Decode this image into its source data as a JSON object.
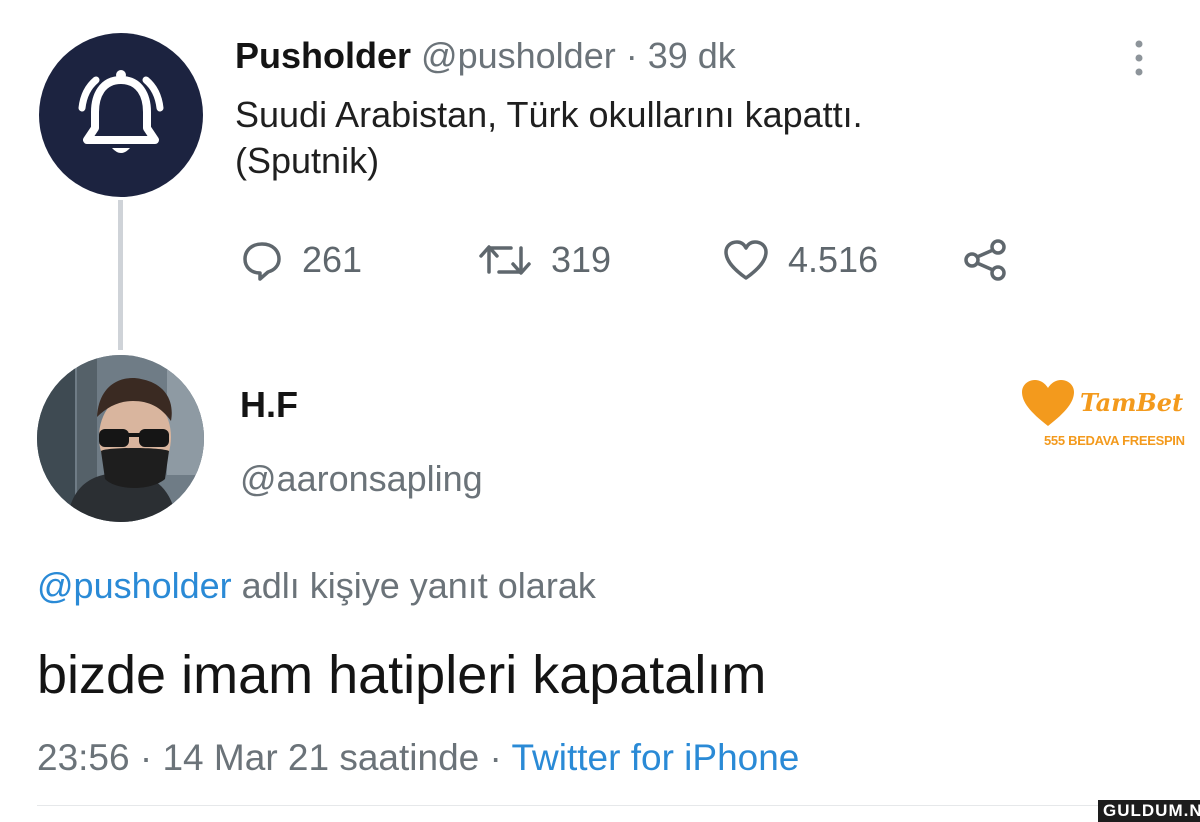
{
  "parent_tweet": {
    "display_name": "Pusholder",
    "handle": "@pusholder",
    "separator": " · ",
    "time_ago": "39 dk",
    "avatar_icon": "bell-icon",
    "text_line1": "Suudi Arabistan, Türk okullarını kapattı.",
    "text_line2": "(Sputnik)",
    "reply_count": "261",
    "retweet_count": "319",
    "like_count": "4.516"
  },
  "reply_tweet": {
    "display_name": "H.F",
    "handle": "@aaronsapling",
    "reply_context_handle": "@pusholder",
    "reply_context_text": " adlı kişiye yanıt olarak",
    "text": "bizde imam hatipleri kapatalım",
    "time": "23:56",
    "separator1": " · ",
    "date_text": "14 Mar 21 saatinde",
    "separator2": " · ",
    "source": "Twitter for iPhone"
  },
  "overlays": {
    "promo_brand": "TamBet",
    "promo_subtitle": "555 BEDAVA FREESPIN",
    "watermark": "GULDUM.NET"
  },
  "colors": {
    "avatar_bg": "#1c2340",
    "link": "#2a8ad6",
    "muted": "#6b7379",
    "promo_orange": "#f39a1d"
  }
}
